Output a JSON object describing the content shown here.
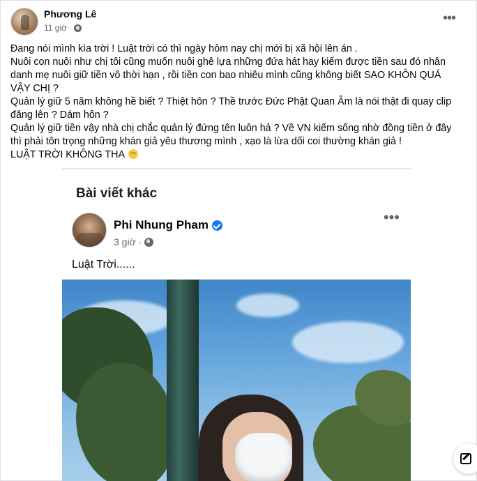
{
  "post": {
    "author": "Phương Lê",
    "time": "11 giờ",
    "separator": "·",
    "more_label": "•••",
    "lines": [
      "Đang nói mình kìa trời ! Luật trời có thì ngày hôm nay chị mới bị xã hội lên án .",
      "Nuôi con nuôi như chị tôi cũng muốn nuôi ghê lựa những đứa hát hay kiếm được tiền sau đó nhân danh mẹ nuôi giữ tiền vô thời hạn , rồi tiền con bao nhiêu mình cũng không biết SAO KHÔN QUÁ VẬY CHỊ ?",
      "Quản lý giữ 5 năm không hề biết ? Thiệt hôn ? Thề trước Đức Phật Quan Âm là nói thật đi quay clip đăng lên ? Dám hôn ?",
      "Quản lý giữ tiền vậy nhà chị chắc quản lý đứng tên luôn hả ? Về VN kiếm sống nhờ đồng tiền ở đây thì phải tôn trọng những khán giả yêu thương mình , xạo là lừa dối coi thường khán giả !",
      "LUẬT TRỜI KHÔNG THA"
    ],
    "emoji": "smirk-face-icon"
  },
  "shared": {
    "heading": "Bài viết khác",
    "author": "Phi Nhung Pham",
    "time": "3 giờ",
    "separator": "·",
    "more_label": "•••",
    "text": "Luật Trời......",
    "verified": true,
    "photo_alt": "woman-with-face-mask-photo"
  },
  "colors": {
    "primary_text": "#050505",
    "secondary_text": "#65676b",
    "verified_blue": "#1877f2",
    "card_bg": "#ffffff"
  }
}
